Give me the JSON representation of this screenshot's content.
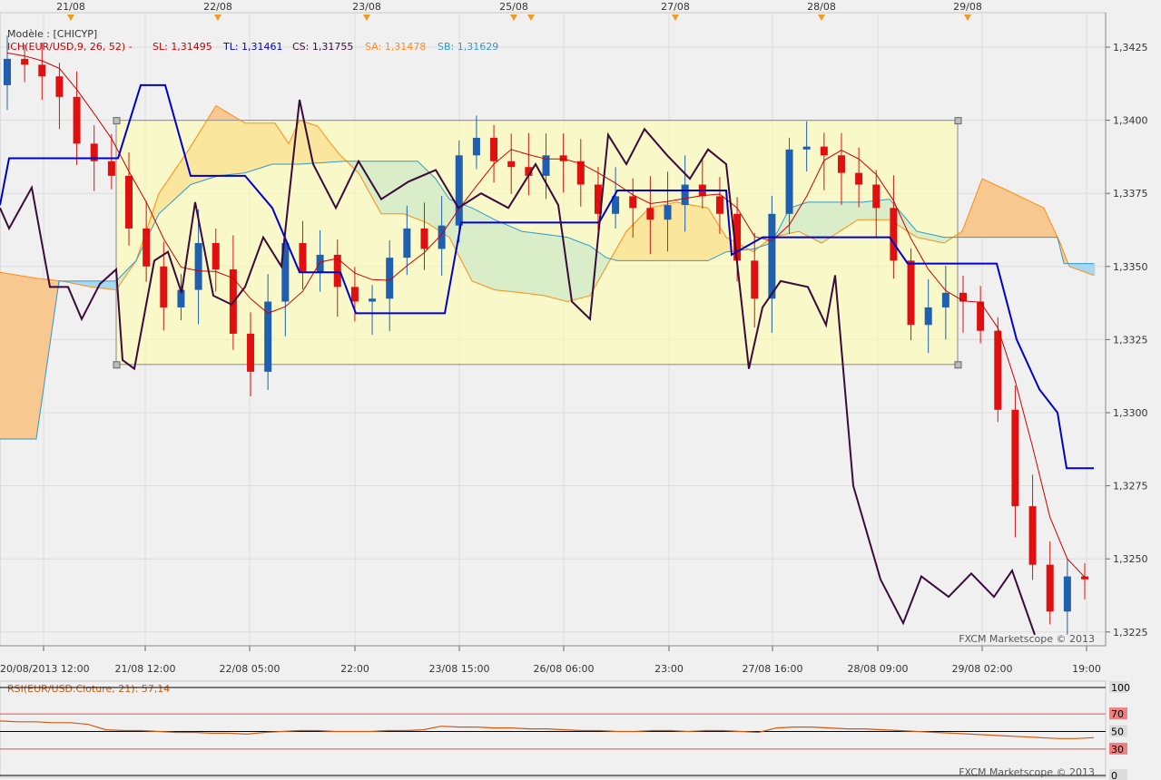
{
  "colors": {
    "background": "#f0f0f0",
    "grid": "#dcdcdc",
    "bull_candle": "#1f5fb0",
    "bear_candle": "#e01010",
    "kijun": "#0000cc",
    "tenkan": "#cc0000",
    "chikou": "#3a0a3a",
    "senkou_a": "#ff8c1a",
    "senkou_b": "#3399cc",
    "cloud_up": "#f7c890",
    "cloud_down": "#a8d8ee",
    "zone_fill": "#ffffaa",
    "rsi_line": "#d05a10"
  },
  "header": {
    "model": "Modèle : [CHICYP]",
    "indicator": "ICH(EUR/USD,9, 26, 52) -",
    "sl": "SL: 1,31495",
    "tl": "TL: 1,31461",
    "cs": "CS: 1,31755",
    "sa": "SA: 1,31478",
    "sb": "SB: 1,31629"
  },
  "watermark": "FXCM Marketscope © 2013",
  "rsi_panel": {
    "title": "RSI(EUR/USD.Cloture, 21): 57,14",
    "levels": [
      "100",
      "70",
      "50",
      "30",
      "0"
    ]
  },
  "chart_data": [
    {
      "type": "candlestick",
      "top_dates": [
        "21/08",
        "22/08",
        "23/08",
        "25/08",
        "27/08",
        "28/08",
        "29/08"
      ],
      "x_tick_labels": [
        "20/08/2013 12:00",
        "21/08 12:00",
        "22/08 05:00",
        "22:00",
        "23/08 15:00",
        "26/08 06:00",
        "23:00",
        "27/08 16:00",
        "28/08 09:00",
        "29/08 02:00",
        "19:00"
      ],
      "y_tick_labels": [
        "1,3425",
        "1,3400",
        "1,3375",
        "1,3350",
        "1,3325",
        "1,3300",
        "1,3275",
        "1,3250",
        "1,3225"
      ],
      "ylim": [
        1.3215,
        1.3432
      ],
      "grid": true,
      "rectangle": {
        "price_top": 1.34,
        "price_bottom": 1.33165,
        "x_from_label": "21/08 12:00",
        "x_to_label": "29/08 02:00"
      },
      "approximate_closes": [
        1.3421,
        1.3419,
        1.3415,
        1.3408,
        1.3392,
        1.3386,
        1.3381,
        1.3363,
        1.335,
        1.3336,
        1.3342,
        1.3358,
        1.3349,
        1.3327,
        1.3314,
        1.3338,
        1.3358,
        1.3348,
        1.3354,
        1.3343,
        1.3338,
        1.3339,
        1.3353,
        1.3363,
        1.3356,
        1.3364,
        1.3388,
        1.3394,
        1.3386,
        1.3384,
        1.3381,
        1.3388,
        1.3386,
        1.3378,
        1.3368,
        1.3374,
        1.337,
        1.3366,
        1.3371,
        1.3378,
        1.3374,
        1.3368,
        1.3352,
        1.3339,
        1.3368,
        1.339,
        1.3391,
        1.3388,
        1.3382,
        1.3378,
        1.337,
        1.3352,
        1.333,
        1.3336,
        1.3341,
        1.3338,
        1.3328,
        1.3301,
        1.3268,
        1.3248,
        1.3232,
        1.3244,
        1.3243
      ]
    },
    {
      "type": "line",
      "name": "RSI",
      "ylim": [
        0,
        100
      ],
      "levels": [
        70,
        50,
        30
      ],
      "values": [
        62,
        61,
        61,
        60,
        60,
        58,
        52,
        51,
        51,
        50,
        49,
        49,
        48,
        48,
        47,
        49,
        50,
        51,
        51,
        50,
        50,
        50,
        51,
        51,
        52,
        56,
        55,
        55,
        54,
        54,
        53,
        53,
        52,
        51,
        51,
        50,
        50,
        51,
        51,
        50,
        51,
        51,
        50,
        49,
        54,
        55,
        55,
        54,
        53,
        53,
        52,
        51,
        50,
        49,
        48,
        47,
        46,
        45,
        44,
        43,
        42,
        42,
        43
      ]
    }
  ]
}
